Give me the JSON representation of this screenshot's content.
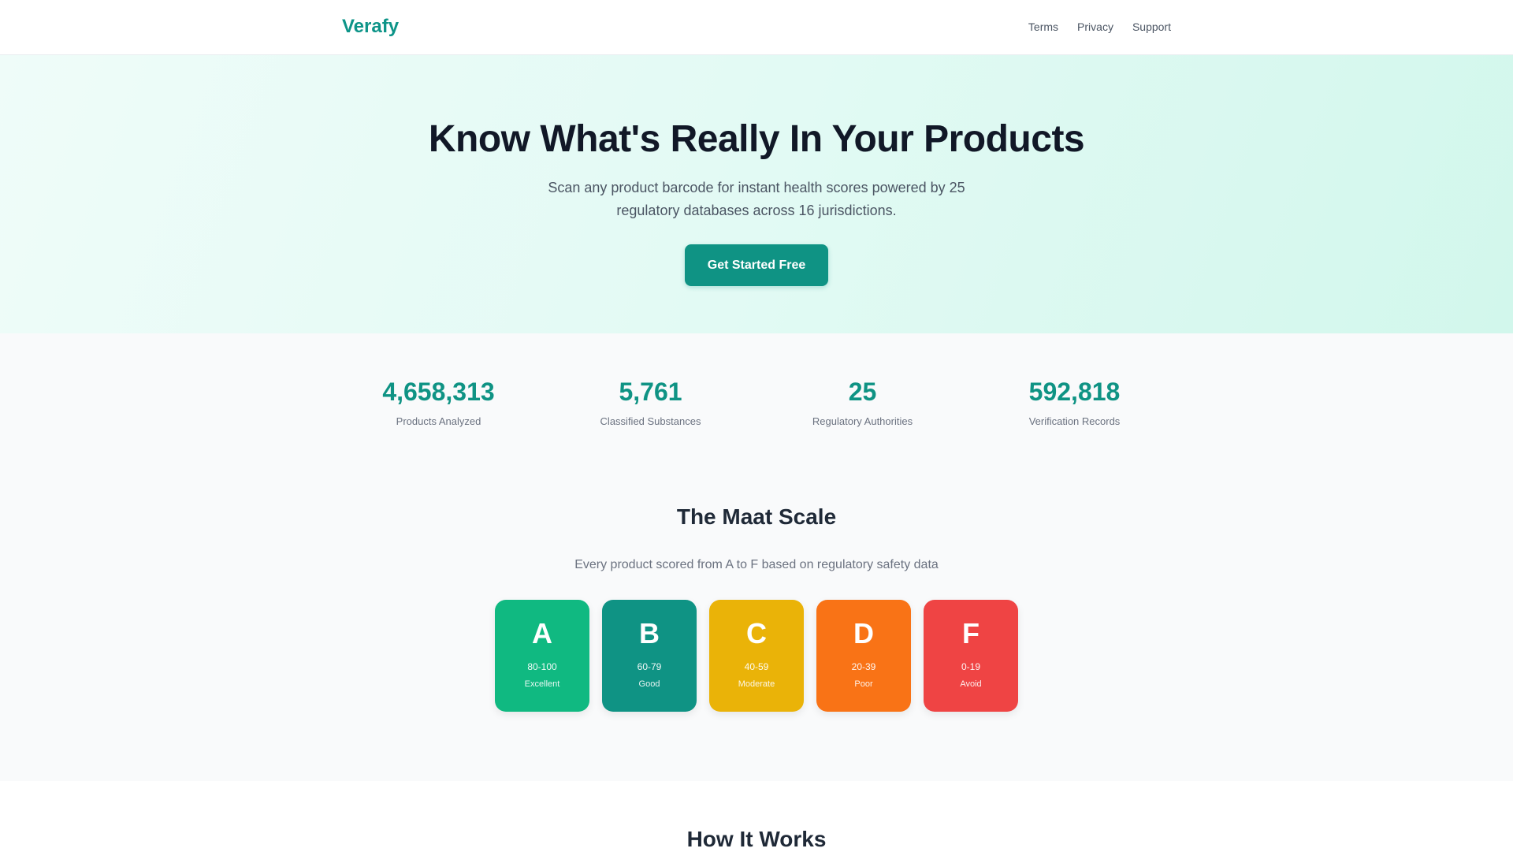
{
  "header": {
    "logo": "Verafy",
    "nav": [
      "Terms",
      "Privacy",
      "Support"
    ]
  },
  "hero": {
    "title": "Know What's Really In Your Products",
    "subtitle": "Scan any product barcode for instant health scores powered by 25 regulatory databases across 16 jurisdictions.",
    "cta_label": "Get Started Free"
  },
  "stats": [
    {
      "value": "4,658,313",
      "label": "Products Analyzed"
    },
    {
      "value": "5,761",
      "label": "Classified Substances"
    },
    {
      "value": "25",
      "label": "Regulatory Authorities"
    },
    {
      "value": "592,818",
      "label": "Verification Records"
    }
  ],
  "scale": {
    "title": "The Maat Scale",
    "subtitle": "Every product scored from A to F based on regulatory safety data",
    "grades": [
      {
        "letter": "A",
        "range": "80-100",
        "label": "Excellent",
        "color": "#10b981"
      },
      {
        "letter": "B",
        "range": "60-79",
        "label": "Good",
        "color": "#0f9384"
      },
      {
        "letter": "C",
        "range": "40-59",
        "label": "Moderate",
        "color": "#eab308"
      },
      {
        "letter": "D",
        "range": "20-39",
        "label": "Poor",
        "color": "#f97316"
      },
      {
        "letter": "F",
        "range": "0-19",
        "label": "Avoid",
        "color": "#ef4444"
      }
    ]
  },
  "how_it_works": {
    "title": "How It Works"
  },
  "colors": {
    "brand": "#0d9488",
    "stat_value": "#0f9384"
  }
}
